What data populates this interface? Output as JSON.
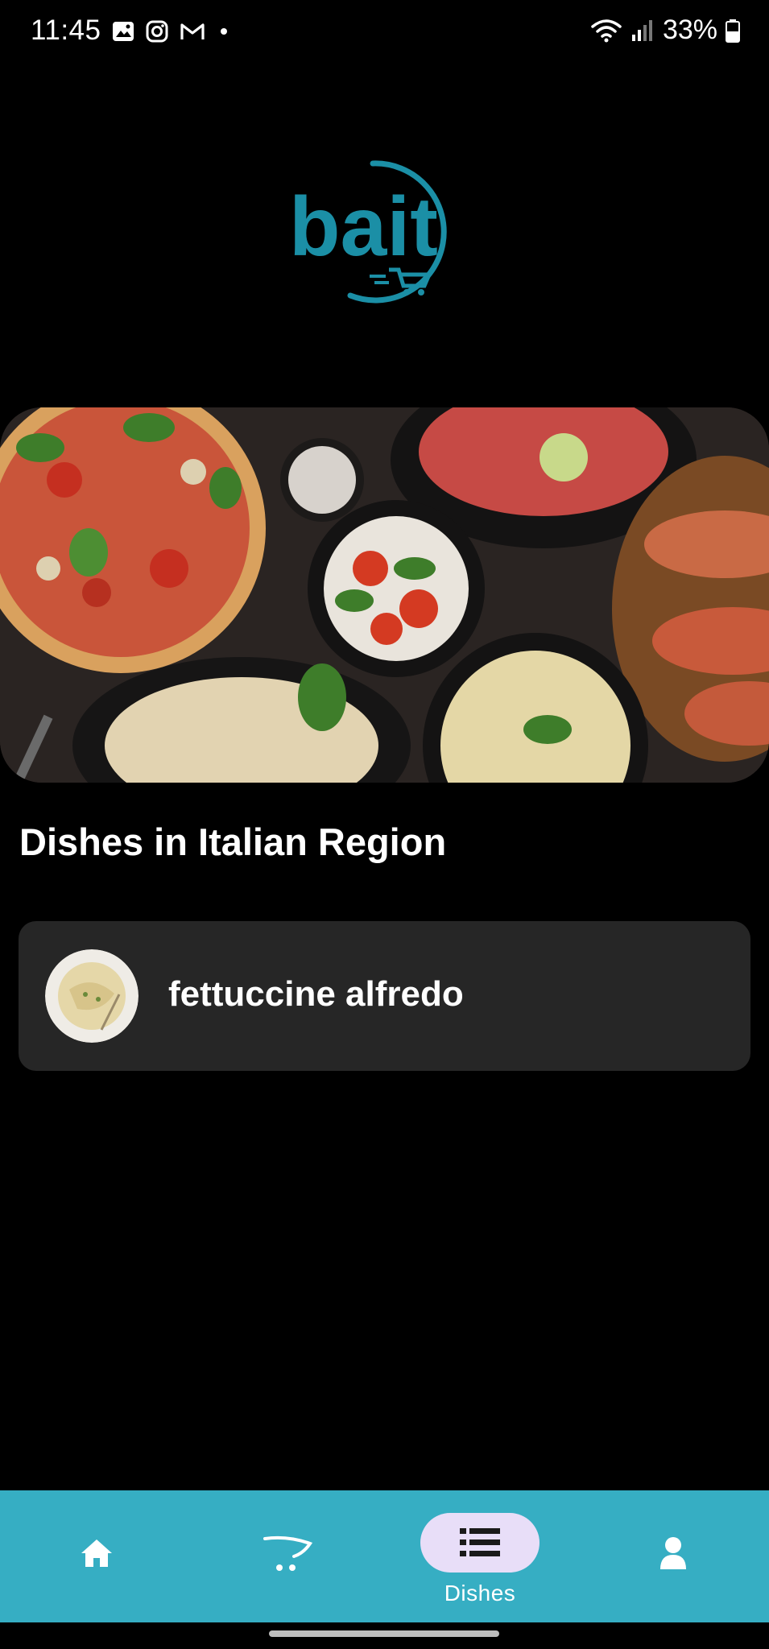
{
  "status_bar": {
    "time": "11:45",
    "battery": "33%"
  },
  "logo": {
    "text": "bait",
    "color": "#1b8fa6"
  },
  "hero": {
    "alt": "Italian dishes spread"
  },
  "section": {
    "title": "Dishes in Italian Region"
  },
  "dishes": [
    {
      "name": "fettuccine alfredo"
    }
  ],
  "nav": {
    "items": [
      {
        "icon": "home-icon",
        "label": ""
      },
      {
        "icon": "cart-icon",
        "label": ""
      },
      {
        "icon": "list-icon",
        "label": "Dishes",
        "selected": true
      },
      {
        "icon": "person-icon",
        "label": ""
      }
    ],
    "bar_color": "#36aec3",
    "selected_pill_color": "#e8def8"
  }
}
